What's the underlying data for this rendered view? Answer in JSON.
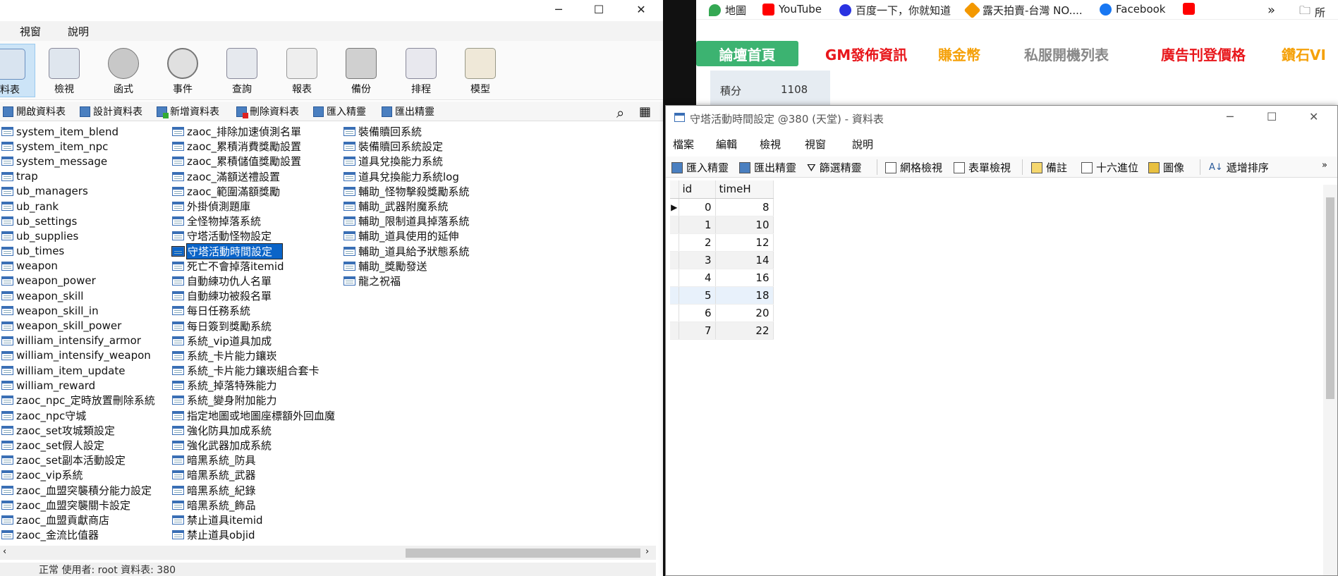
{
  "left_window": {
    "controls": {
      "minimize": "─",
      "maximize": "☐",
      "close": "✕"
    },
    "menu": [
      "視窗",
      "說明"
    ],
    "toolbar": [
      {
        "label": "料表",
        "icon": "table-icon"
      },
      {
        "label": "檢視",
        "icon": "view-icon"
      },
      {
        "label": "函式",
        "icon": "function-icon"
      },
      {
        "label": "事件",
        "icon": "event-icon"
      },
      {
        "label": "查詢",
        "icon": "query-icon"
      },
      {
        "label": "報表",
        "icon": "report-icon"
      },
      {
        "label": "備份",
        "icon": "backup-icon"
      },
      {
        "label": "排程",
        "icon": "schedule-icon"
      },
      {
        "label": "模型",
        "icon": "model-icon"
      }
    ],
    "subtoolbar": [
      "開啟資料表",
      "設計資料表",
      "新增資料表",
      "刪除資料表",
      "匯入精靈",
      "匯出精靈"
    ],
    "tables_col1": [
      "system_item_blend",
      "system_item_npc",
      "system_message",
      "trap",
      "ub_managers",
      "ub_rank",
      "ub_settings",
      "ub_supplies",
      "ub_times",
      "weapon",
      "weapon_power",
      "weapon_skill",
      "weapon_skill_in",
      "weapon_skill_power",
      "william_intensify_armor",
      "william_intensify_weapon",
      "william_item_update",
      "william_reward",
      "zaoc_npc_定時放置刪除系統",
      "zaoc_npc守城",
      "zaoc_set攻城類設定",
      "zaoc_set假人設定",
      "zaoc_set副本活動設定",
      "zaoc_vip系統",
      "zaoc_血盟突襲積分能力設定",
      "zaoc_血盟突襲關卡設定",
      "zaoc_血盟貢獻商店",
      "zaoc_金流比值器"
    ],
    "tables_col2": [
      "zaoc_排除加速偵測名單",
      "zaoc_累積消費獎勵設置",
      "zaoc_累積儲值獎勵設置",
      "zaoc_滿額送禮設置",
      "zaoc_範圍滿額獎勵",
      "外掛偵測題庫",
      "全怪物掉落系統",
      "守塔活動怪物設定",
      "守塔活動時間設定",
      "死亡不會掉落itemid",
      "自動練功仇人名單",
      "自動練功被殺名單",
      "每日任務系統",
      "每日簽到獎勵系統",
      "系統_vip道具加成",
      "系統_卡片能力鑲崁",
      "系統_卡片能力鑲崁組合套卡",
      "系統_掉落特殊能力",
      "系統_變身附加能力",
      "指定地圖或地圖座標額外回血魔",
      "強化防具加成系統",
      "強化武器加成系統",
      "暗黑系統_防具",
      "暗黑系統_武器",
      "暗黑系統_紀錄",
      "暗黑系統_飾品",
      "禁止道具itemid",
      "禁止道具objid"
    ],
    "tables_col3": [
      "裝備贖回系統",
      "裝備贖回系統設定",
      "道具兌換能力系統",
      "道具兌換能力系統log",
      "輔助_怪物擊殺獎勵系統",
      "輔助_武器附魔系統",
      "輔助_限制道具掉落系統",
      "輔助_道具使用的延伸",
      "輔助_道具給予狀態系統",
      "輔助_獎勵發送",
      "龍之祝福"
    ],
    "selected": "守塔活動時間設定",
    "status": "正常  使用者: root  資料表: 380"
  },
  "browser": {
    "bookmarks": [
      {
        "label": "地圖",
        "color": "#34a853"
      },
      {
        "label": "YouTube",
        "color": "#ff0000"
      },
      {
        "label": "百度一下，你就知道",
        "color": "#2932e1"
      },
      {
        "label": "露天拍賣-台灣 NO....",
        "color": "#f39800"
      },
      {
        "label": "Facebook",
        "color": "#1877f2"
      },
      {
        "label": "",
        "color": "#ff0000"
      }
    ],
    "more": "»",
    "folder": "所",
    "nav": [
      {
        "label": "論壇首頁",
        "color": "#ffffff",
        "bg": "#3cb371"
      },
      {
        "label": "GM發佈資訊",
        "color": "#e8171c",
        "bg": ""
      },
      {
        "label": "賺金幣",
        "color": "#f5a10a",
        "bg": ""
      },
      {
        "label": "私服開機列表",
        "color": "#888888",
        "bg": ""
      },
      {
        "label": "廣告刊登價格",
        "color": "#e8171c",
        "bg": ""
      },
      {
        "label": "鑽石VI",
        "color": "#f5a10a",
        "bg": ""
      }
    ],
    "stat_label": "積分",
    "stat_value": "1108"
  },
  "table_window": {
    "title": "守塔活動時間設定 @380 (天堂) - 資料表",
    "menu": [
      "檔案",
      "編輯",
      "檢視",
      "視窗",
      "說明"
    ],
    "toolbar": [
      "匯入精靈",
      "匯出精靈",
      "篩選精靈",
      "網格檢視",
      "表單檢視",
      "備註",
      "十六進位",
      "圖像",
      "遞增排序"
    ],
    "more": "»",
    "columns": [
      "id",
      "timeH"
    ],
    "rows": [
      {
        "id": "0",
        "timeH": "8"
      },
      {
        "id": "1",
        "timeH": "10"
      },
      {
        "id": "2",
        "timeH": "12"
      },
      {
        "id": "3",
        "timeH": "14"
      },
      {
        "id": "4",
        "timeH": "16"
      },
      {
        "id": "5",
        "timeH": "18"
      },
      {
        "id": "6",
        "timeH": "20"
      },
      {
        "id": "7",
        "timeH": "22"
      }
    ]
  }
}
